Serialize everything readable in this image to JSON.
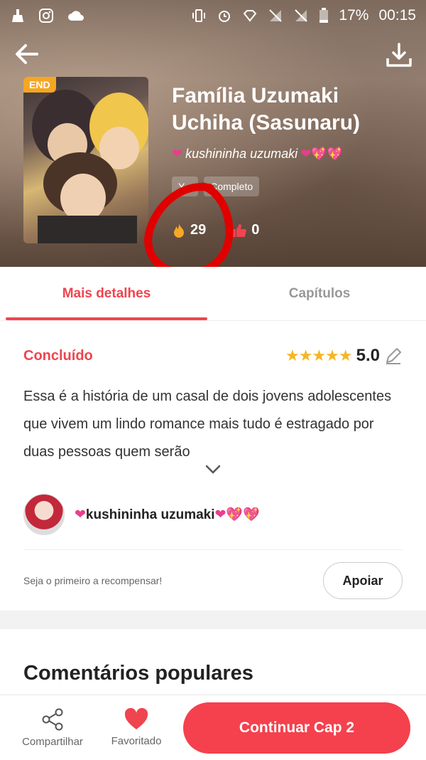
{
  "status_bar": {
    "battery": "17%",
    "time": "00:15"
  },
  "story": {
    "badge": "END",
    "title": "Família Uzumaki Uchiha (Sasunaru)",
    "author": "kushininha uzumaki",
    "tags": [
      "Y...",
      "Completo"
    ],
    "views": "29",
    "likes": "0"
  },
  "tabs": [
    {
      "label": "Mais detalhes",
      "active": true
    },
    {
      "label": "Capítulos",
      "active": false
    }
  ],
  "details": {
    "status": "Concluído",
    "stars": "★★★★★",
    "rating": "5.0",
    "description": "Essa é a história de um casal de dois jovens adolescentes que vivem um lindo romance mais tudo é estragado por duas pessoas quem serão",
    "author_name": "kushininha uzumaki",
    "reward_text": "Seja o primeiro a recompensar!",
    "support_button": "Apoiar"
  },
  "comments": {
    "title": "Comentários populares"
  },
  "bottom_bar": {
    "share_label": "Compartilhar",
    "favorite_label": "Favoritado",
    "continue_label": "Continuar Cap 2"
  },
  "colors": {
    "accent": "#f0444f",
    "star": "#f5b623",
    "badge": "#f5a623"
  }
}
